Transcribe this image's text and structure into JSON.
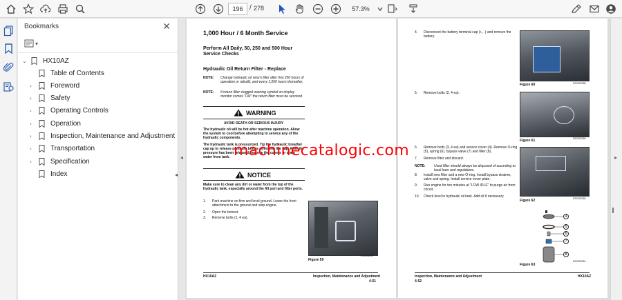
{
  "toolbar": {
    "page_current": "196",
    "page_separator": "/",
    "page_total": "278",
    "zoom": "57.3%"
  },
  "sidebar": {
    "title": "Bookmarks",
    "root": "HX10AZ",
    "items": [
      {
        "label": "Table of Contents",
        "expandable": false
      },
      {
        "label": "Foreword",
        "expandable": true
      },
      {
        "label": "Safety",
        "expandable": true
      },
      {
        "label": "Operating Controls",
        "expandable": true
      },
      {
        "label": "Operation",
        "expandable": true
      },
      {
        "label": "Inspection, Maintenance and Adjustment",
        "expandable": true
      },
      {
        "label": "Transportation",
        "expandable": true
      },
      {
        "label": "Specification",
        "expandable": true
      },
      {
        "label": "Index",
        "expandable": false
      }
    ]
  },
  "page_left": {
    "title": "1,000 Hour / 6 Month Service",
    "subtitle": "Perform All Daily, 50, 250 and 500 Hour Service Checks",
    "section": "Hydraulic Oil Return Filter - Replace",
    "note1_label": "NOTE:",
    "note1": "Change hydraulic oil return filter after first 250 hours of operation or rebuild, and every 1,000 hours thereafter.",
    "note2_label": "NOTE:",
    "note2": "If return filter clogged warning symbol on display monitor comes \"ON\" the return filter must be serviced.",
    "warning_title": "WARNING",
    "warning_sub": "AVOID DEATH OR SERIOUS INJURY",
    "warning_text1": "The hydraulic oil will be hot after machine operation. Allow the system to cool before attempting to service any of the hydraulic components.",
    "warning_text2": "The hydraulic tank is pressurized. Tip the hydraulic breather cap up to release pressure before removing the cap. After the pressure has been released, remove the covers or drain water from tank.",
    "notice_title": "NOTICE",
    "notice_text": "Make sure to clean any dirt or water from the top of the hydraulic tank, especially around the fill port and filter ports.",
    "steps": [
      {
        "n": "1.",
        "text": "Park machine on firm and level ground. Lower the front attachment to the ground and stop engine."
      },
      {
        "n": "2.",
        "text": "Open the bonnet."
      },
      {
        "n": "3.",
        "text": "Remove bolts (1, 4 ea)."
      }
    ],
    "figure_label": "Figure 59",
    "figure_code": "DS2302267",
    "footer_left": "HX10AZ",
    "footer_right": "Inspection, Maintenance and Adjustment",
    "footer_num": "4-51"
  },
  "page_right": {
    "steps": [
      {
        "n": "4.",
        "text": "Disconnect the battery terminal cap (+, -) and remove the battery."
      },
      {
        "n": "5.",
        "text": "Remove bolts (2, 4 ea)."
      },
      {
        "n": "6.",
        "text": "Remove bolts (3, 4 ea) and service cover (4). Remove O-ring (5), spring (6), bypass valve (7) and filter (8)."
      },
      {
        "n": "7.",
        "text": "Remove filter and discard."
      },
      {
        "n": "8.",
        "text": "Install new filter and a new O-ring. Install bypass strainer, valve and spring. Install service cover plate."
      },
      {
        "n": "9.",
        "text": "Run engine for ten minutes at \"LOW IDLE\" to purge air from circuit."
      },
      {
        "n": "10.",
        "text": "Check level in hydraulic oil tank. Add oil if necessary."
      }
    ],
    "note_label": "NOTE:",
    "note": "Used filter should always be disposed of according to local laws and regulations.",
    "figures": [
      {
        "label": "Figure 60",
        "code": "DS2302268"
      },
      {
        "label": "Figure 61",
        "code": "DS2302269"
      },
      {
        "label": "Figure 62",
        "code": "DS2302260"
      },
      {
        "label": "Figure 63",
        "code": "DS2302261"
      }
    ],
    "callouts": [
      "4",
      "5",
      "6",
      "7",
      "8"
    ],
    "footer_left": "Inspection, Maintenance and Adjustment",
    "footer_num": "4-52",
    "footer_right": "HX10AZ"
  },
  "watermark": "machinecatalogic.com"
}
